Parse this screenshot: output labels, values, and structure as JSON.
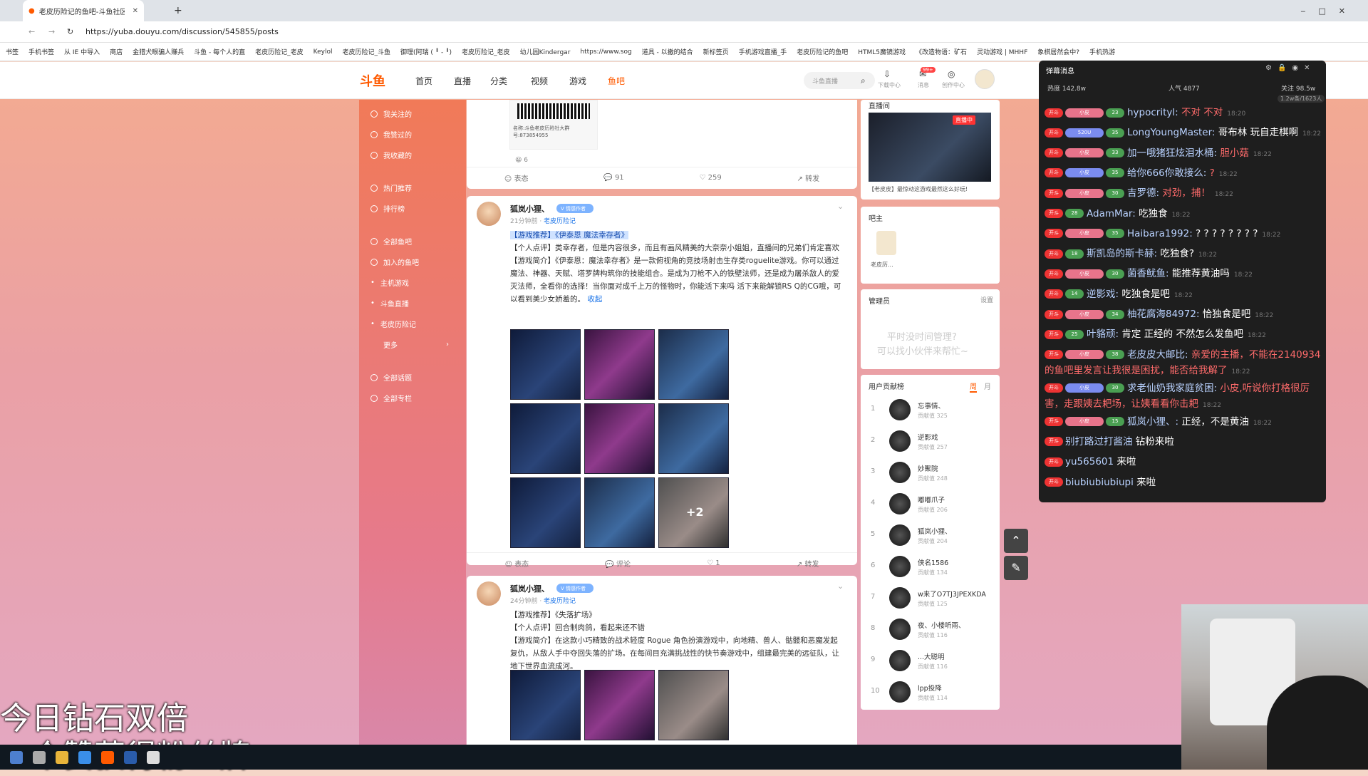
{
  "browser": {
    "tab_title": "老皮历险记的鱼吧-斗鱼社区,直播...",
    "url": "https://yuba.douyu.com/discussion/545855/posts",
    "bookmarks": [
      "书签",
      "手机书签",
      "从 IE 中导入",
      "商店",
      "金猎犬眼骗人赚兵",
      "斗鱼 - 每个人的直",
      "老皮历险记_老皮",
      "Keylol",
      "老皮历险记_斗鱼",
      "御理(阿瑞 ( ╹ - ╹)",
      "老皮历险记_老皮",
      "幼儿园Kindergar",
      "https://www.sog",
      "道具 - 以撒的结合",
      "新标签页",
      "手机游戏直播_手",
      "老皮历险记的鱼吧",
      "HTML5魔镜游戏",
      "《改造物语：矿石",
      "灵动游戏 | MHHF",
      "象棋居然会中?",
      "手机热游"
    ]
  },
  "nav": {
    "logo": "斗鱼",
    "links": [
      "首页",
      "直播",
      "分类",
      "视频",
      "游戏",
      "鱼吧"
    ],
    "search_placeholder": "斗鱼直播",
    "icons": [
      {
        "label": "下载中心"
      },
      {
        "label": "消息",
        "badge": "99+"
      },
      {
        "label": "创作中心"
      }
    ]
  },
  "sidebar": {
    "items": [
      "我关注的",
      "我赞过的",
      "我收藏的",
      "热门推荐",
      "排行榜",
      "全部鱼吧",
      "加入的鱼吧",
      "主机游戏",
      "斗鱼直播",
      "老皮历险记",
      "更多",
      "全部话题",
      "全部专栏"
    ]
  },
  "feed": {
    "top_card": {
      "qr_caption": "名称:斗鱼老皮历险社大群 号:873854955",
      "reactions": "6",
      "actions": {
        "express": "表态",
        "comments": "91",
        "likes": "259",
        "share": "转发"
      }
    },
    "posts": [
      {
        "user": "狐岚小狸、",
        "badge": "V 情感作者",
        "time": "21分钟前",
        "group": "老皮历险记",
        "lines": [
          "【游戏推荐】《伊泰恩 魔法幸存者》",
          "【个人点评】类幸存者，但是内容很多，而且有画风精美的大奈奈小姐姐，直播间的兄弟们肯定喜欢",
          "【游戏简介】《伊泰恩：魔法幸存者》是一款俯视角的竞技场射击生存类roguelite游戏。你可以通过魔法、神器、天赋、塔罗牌构筑你的技能组合。是成为刀枪不入的铁壁法师，还是成为屠杀敌人的爱灭法师，全看你的选择！当你面对成千上万的怪物时，你能活下来吗 活下来能解锁RS Q的CG哦，可以看到美少女娇羞的。"
        ],
        "collapse": "收起",
        "more_count": "+2",
        "actions": {
          "express": "表态",
          "comments": "评论",
          "likes": "1",
          "share": "转发"
        }
      },
      {
        "user": "狐岚小狸、",
        "badge": "V 情感作者",
        "time": "24分钟前",
        "group": "老皮历险记",
        "lines": [
          "【游戏推荐】《失落扩场》",
          "【个人点评】回合制肉鸽，看起来还不错",
          "【游戏简介】在这款小巧精致的战术轻度 Rogue 角色扮演游戏中，向地精、兽人、骷髅和恶魔发起复仇，从敌人手中夺回失落的扩场。在每间目充满挑战性的快节奏游戏中，组建最完美的远征队，让地下世界血流成河。"
        ]
      }
    ]
  },
  "right": {
    "live_label": "直播间",
    "live_badge": "直播中",
    "live_caption": "【老皮皮】最惊动这游戏最然这么好玩!",
    "owner_label": "吧主",
    "owner_name": "老皮历...",
    "admin_label": "管理员",
    "admin_set": "设置",
    "admin_empty_1": "平时没时间管理?",
    "admin_empty_2": "可以找小伙伴来帮忙~",
    "rank_title": "用户贡献榜",
    "rank_tabs": [
      "周",
      "月"
    ],
    "rank": [
      {
        "n": "1",
        "name": "忘事情、",
        "val": "贡献值 325"
      },
      {
        "n": "2",
        "name": "逆影戏",
        "val": "贡献值 257"
      },
      {
        "n": "3",
        "name": "妙聚院",
        "val": "贡献值 248"
      },
      {
        "n": "4",
        "name": "嘟嘟爪子",
        "val": "贡献值 206"
      },
      {
        "n": "5",
        "name": "狐岚小狸、",
        "val": "贡献值 204"
      },
      {
        "n": "6",
        "name": "侠名1586",
        "val": "贡献值 134"
      },
      {
        "n": "7",
        "name": "w来了O7TJ3JPEXKDA",
        "val": "贡献值 125"
      },
      {
        "n": "8",
        "name": "夜、小楼听雨、",
        "val": "贡献值 116"
      },
      {
        "n": "9",
        "name": "...大聪明",
        "val": "贡献值 116"
      },
      {
        "n": "10",
        "name": "lpp投降",
        "val": "贡献值 114"
      }
    ]
  },
  "danmu": {
    "title": "弹幕消息",
    "heat": "热度 142.8w",
    "popularity": "人气 4877",
    "follow": "关注 98.5w",
    "count": "1.2w条/1623人",
    "messages": [
      {
        "lvl": "开斗",
        "fan": "小皮",
        "uid": "23",
        "name": "hypocrityl:",
        "msg": "不对 不对",
        "time": "18:20",
        "red": true
      },
      {
        "lvl": "开斗",
        "fan": "520U",
        "uid": "35",
        "name": "LongYoungMaster:",
        "msg": "哥布林 玩自走棋啊",
        "time": "18:22"
      },
      {
        "lvl": "开斗",
        "fan": "小皮",
        "uid": "33",
        "name": "加一哦猪狂炫泪水桶:",
        "msg": "胆小菇",
        "time": "18:22",
        "red": true
      },
      {
        "lvl": "开斗",
        "fan": "小皮",
        "uid": "35",
        "name": "给你666你敢接么:",
        "msg": "?",
        "time": "18:22",
        "red": true
      },
      {
        "lvl": "开斗",
        "fan": "小皮",
        "uid": "30",
        "name": "吉罗德:",
        "msg": "对劲，捕！",
        "time": "18:22",
        "red": true
      },
      {
        "lvl": "开斗",
        "fan": "",
        "uid": "28",
        "name": "AdamMar:",
        "msg": "吃独食",
        "time": "18:22"
      },
      {
        "lvl": "开斗",
        "fan": "小皮",
        "uid": "35",
        "name": "Haibara1992:",
        "msg": "? ? ? ? ? ? ? ?",
        "time": "18:22"
      },
      {
        "lvl": "开斗",
        "fan": "",
        "uid": "18",
        "name": "斯凯岛的斯卡赫:",
        "msg": "吃独食?",
        "time": "18:22"
      },
      {
        "lvl": "开斗",
        "fan": "小皮",
        "uid": "30",
        "name": "菌香鱿鱼:",
        "msg": "能推荐黄油吗",
        "time": "18:22"
      },
      {
        "lvl": "开斗",
        "fan": "",
        "uid": "14",
        "name": "逆影戏:",
        "msg": "吃独食是吧",
        "time": "18:22"
      },
      {
        "lvl": "开斗",
        "fan": "小皮",
        "uid": "34",
        "name": "柚花腐海84972:",
        "msg": "恰独食是吧",
        "time": "18:22"
      },
      {
        "lvl": "开斗",
        "fan": "",
        "uid": "25",
        "name": "叶貉顽:",
        "msg": "肯定 正经的 不然怎么发鱼吧",
        "time": "18:22"
      },
      {
        "lvl": "开斗",
        "fan": "小皮",
        "uid": "38",
        "name": "老皮皮大邮比:",
        "msg": "亲爱的主播，不能在2140934的鱼吧里发言让我很是困扰，能否给我解了",
        "time": "18:22",
        "red": true,
        "wrap": true
      },
      {
        "lvl": "开斗",
        "fan": "小皮",
        "uid": "30",
        "name": "求老仙奶我家庭贫困:",
        "msg": "小皮,听说你打格很厉害，走跟姨去耙场，让姨看看你击耙",
        "time": "18:22",
        "red": true,
        "wrap": true
      },
      {
        "lvl": "开斗",
        "fan": "小皮",
        "uid": "15",
        "name": "狐岚小狸、:",
        "msg": "正经，不是黄油",
        "time": "18:22"
      },
      {
        "lvl": "开斗",
        "fan": "",
        "uid": "",
        "name": "别打路过打酱油",
        "msg": "钻粉来啦",
        "time": ""
      },
      {
        "lvl": "开斗",
        "fan": "",
        "uid": "",
        "name": "yu565601",
        "msg": "来啦",
        "time": ""
      },
      {
        "lvl": "开斗",
        "fan": "",
        "uid": "",
        "name": "biubiubiubiupi",
        "msg": "来啦",
        "time": ""
      }
    ]
  },
  "overlay": {
    "line1": "今日钻石双倍",
    "line2": "一个赞获得粉丝牌"
  },
  "colors": {
    "brand": "#ff5a00",
    "sidebar": "#f17a58",
    "danmu_bg": "#1e1e1e"
  }
}
